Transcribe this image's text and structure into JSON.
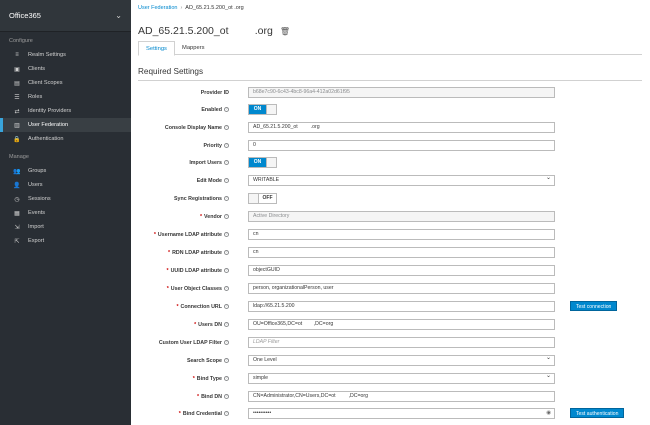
{
  "sidebar": {
    "realm": "Office365",
    "configure_heading": "Configure",
    "configure_items": [
      {
        "label": "Realm Settings",
        "icon": "sliders-icon",
        "glyph": "≡"
      },
      {
        "label": "Clients",
        "icon": "cube-icon",
        "glyph": "▣"
      },
      {
        "label": "Client Scopes",
        "icon": "scopes-icon",
        "glyph": "▤"
      },
      {
        "label": "Roles",
        "icon": "roles-icon",
        "glyph": "☰"
      },
      {
        "label": "Identity Providers",
        "icon": "exchange-icon",
        "glyph": "⇄"
      },
      {
        "label": "User Federation",
        "icon": "database-icon",
        "glyph": "▥"
      },
      {
        "label": "Authentication",
        "icon": "lock-icon",
        "glyph": "🔒"
      }
    ],
    "manage_heading": "Manage",
    "manage_items": [
      {
        "label": "Groups",
        "icon": "users-group-icon",
        "glyph": "👥"
      },
      {
        "label": "Users",
        "icon": "user-icon",
        "glyph": "👤"
      },
      {
        "label": "Sessions",
        "icon": "clock-icon",
        "glyph": "◷"
      },
      {
        "label": "Events",
        "icon": "calendar-icon",
        "glyph": "▦"
      },
      {
        "label": "Import",
        "icon": "import-icon",
        "glyph": "⇲"
      },
      {
        "label": "Export",
        "icon": "export-icon",
        "glyph": "⇱"
      }
    ]
  },
  "breadcrumb": {
    "parent": "User Federation",
    "current": "AD_65.21.5.200_ot         .org"
  },
  "title": "AD_65.21.5.200_ot         .org",
  "tabs": [
    "Settings",
    "Mappers"
  ],
  "section_title": "Required Settings",
  "fields": {
    "provider_id": {
      "label": "Provider ID",
      "value": "b68e7c90-6c43-4bc8-96a4-412a02d61f95"
    },
    "enabled": {
      "label": "Enabled",
      "state": "ON"
    },
    "console_display_name": {
      "label": "Console Display Name",
      "value": "AD_65.21.5.200_ot         .org"
    },
    "priority": {
      "label": "Priority",
      "value": "0"
    },
    "import_users": {
      "label": "Import Users",
      "state": "ON"
    },
    "edit_mode": {
      "label": "Edit Mode",
      "value": "WRITABLE"
    },
    "sync_registrations": {
      "label": "Sync Registrations",
      "state": "OFF"
    },
    "vendor": {
      "label": "Vendor",
      "value": "Active Directory"
    },
    "username_ldap_attribute": {
      "label": "Username LDAP attribute",
      "value": "cn"
    },
    "rdn_ldap_attribute": {
      "label": "RDN LDAP attribute",
      "value": "cn"
    },
    "uuid_ldap_attribute": {
      "label": "UUID LDAP attribute",
      "value": "objectGUID"
    },
    "user_object_classes": {
      "label": "User Object Classes",
      "value": "person, organizationalPerson, user"
    },
    "connection_url": {
      "label": "Connection URL",
      "value": "ldap://65.21.5.200"
    },
    "users_dn": {
      "label": "Users DN",
      "value": "OU=Office365,DC=ot        ,DC=org"
    },
    "custom_user_ldap_filter": {
      "label": "Custom User LDAP Filter",
      "placeholder": "LDAP Filter"
    },
    "search_scope": {
      "label": "Search Scope",
      "value": "One Level"
    },
    "bind_type": {
      "label": "Bind Type",
      "value": "simple"
    },
    "bind_dn": {
      "label": "Bind DN",
      "value": "CN=Administrator,CN=Users,DC=ot         ,DC=org"
    },
    "bind_credential": {
      "label": "Bind Credential",
      "value": "••••••••••"
    }
  },
  "buttons": {
    "test_connection": "Test connection",
    "test_authentication": "Test authentication"
  },
  "colors": {
    "accent": "#0088ce",
    "sidebar_bg": "#292e34",
    "required": "#cc0000"
  }
}
